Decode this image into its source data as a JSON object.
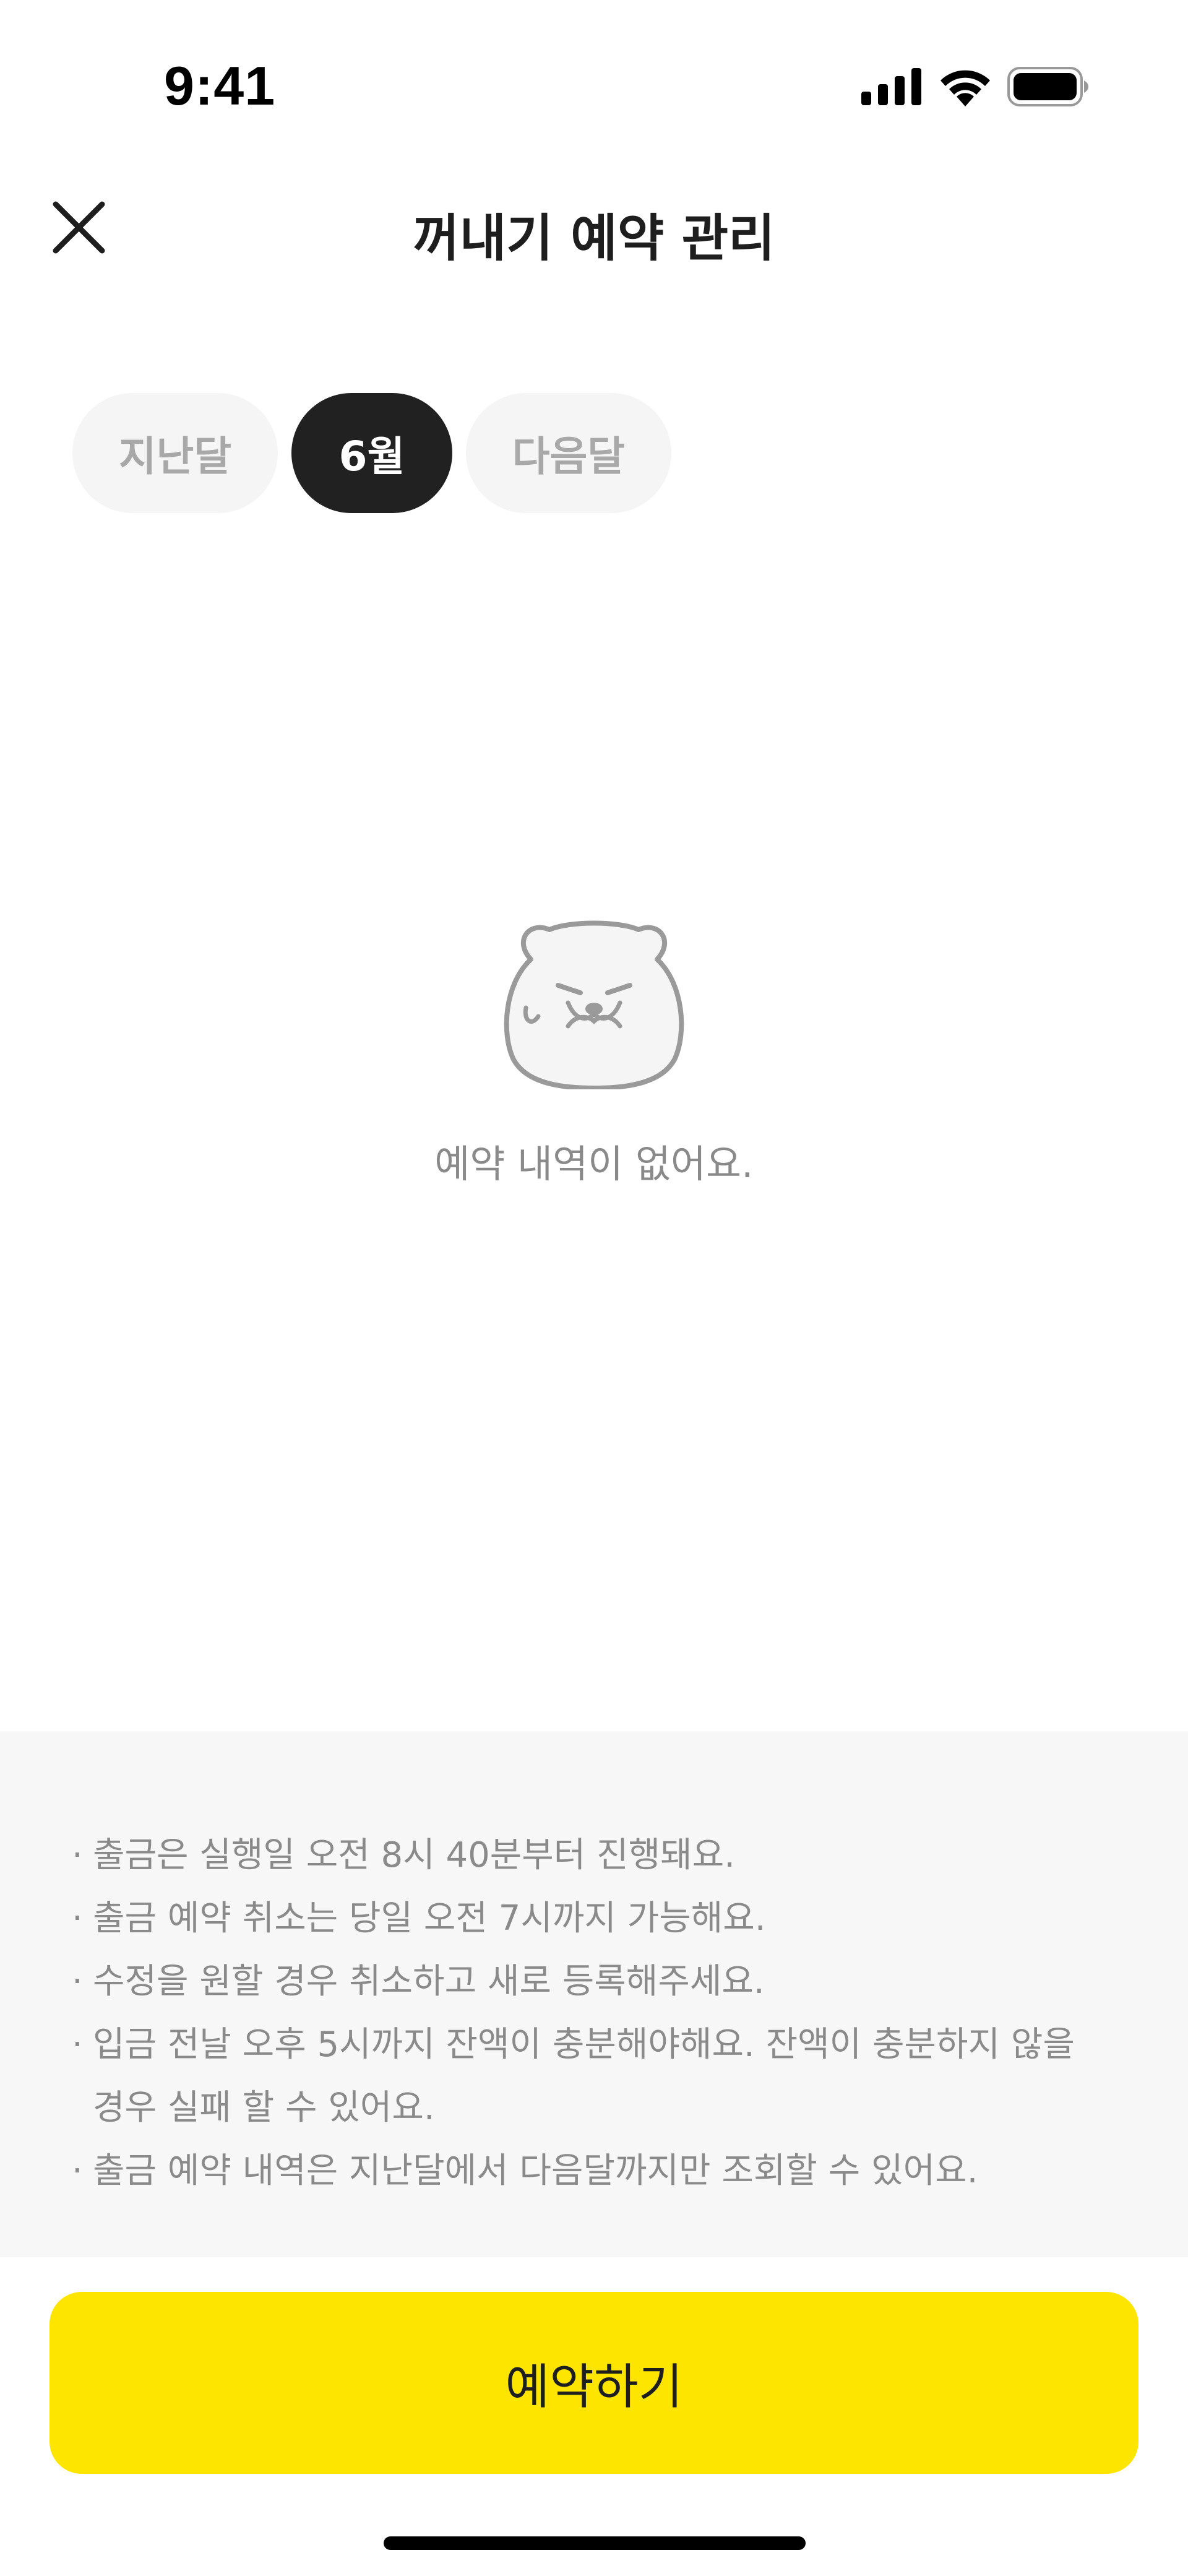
{
  "status_bar": {
    "time": "9:41",
    "icons": [
      "signal-icon",
      "wifi-icon",
      "battery-icon"
    ]
  },
  "nav": {
    "title": "꺼내기 예약 관리",
    "close_icon": "close-icon"
  },
  "tabs": [
    {
      "label": "지난달",
      "selected": false
    },
    {
      "label": "6월",
      "selected": true
    },
    {
      "label": "다음달",
      "selected": false
    }
  ],
  "empty_state": {
    "icon": "character-face-icon",
    "message": "예약 내역이 없어요."
  },
  "notice": {
    "items": [
      "출금은 실행일 오전 8시 40분부터 진행돼요.",
      "출금 예약 취소는 당일 오전 7시까지 가능해요.",
      "수정을 원할 경우 취소하고 새로 등록해주세요.",
      "입금 전날 오후 5시까지 잔액이 충분해야해요. 잔액이 충분하지 않을 경우 실패 할 수 있어요.",
      "출금 예약 내역은 지난달에서 다음달까지만 조회할 수 있어요."
    ]
  },
  "cta": {
    "label": "예약하기"
  },
  "colors": {
    "accent": "#FEE500",
    "selected_tab": "#212121",
    "unselected_tab_bg": "#F5F5F5",
    "unselected_tab_text": "#A8A8A8",
    "notice_bg": "#F7F7F7",
    "muted_text": "#8A8A8A"
  }
}
